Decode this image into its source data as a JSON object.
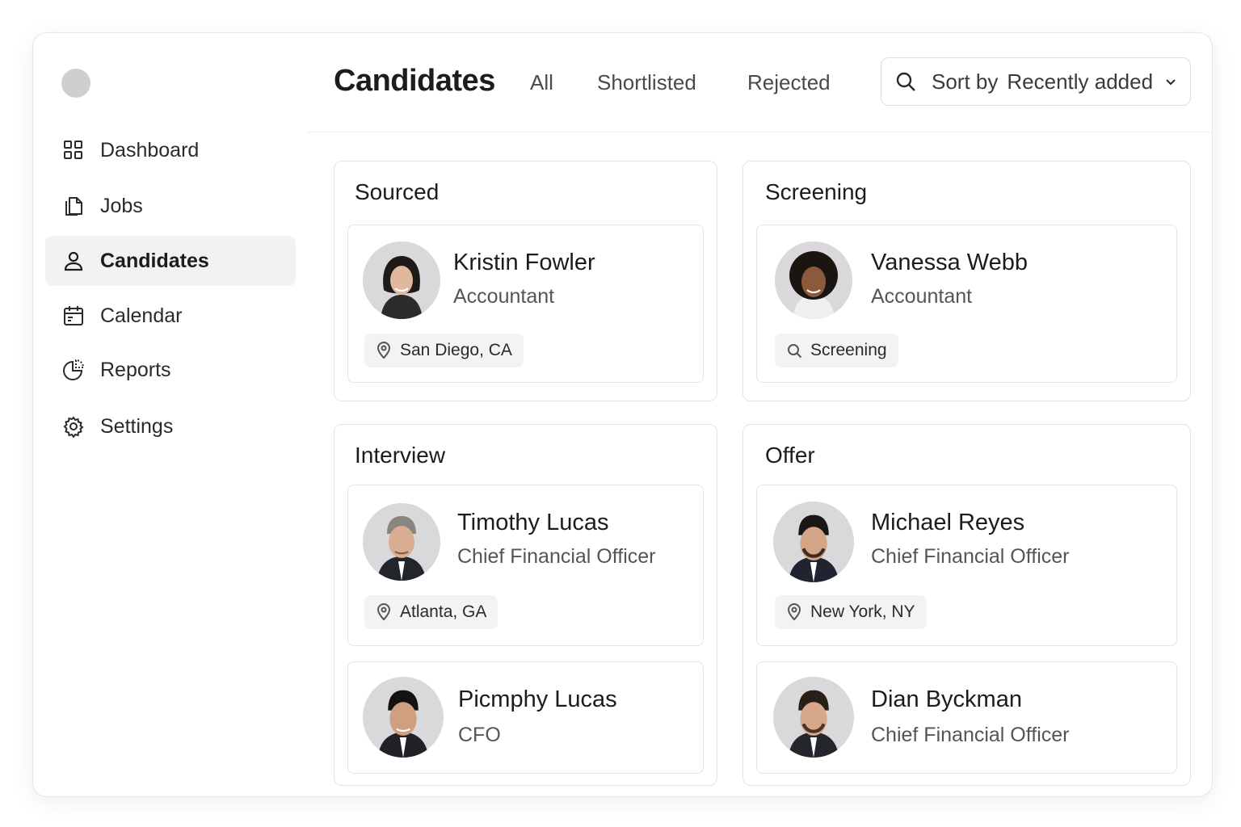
{
  "sidebar": {
    "items": [
      {
        "label": "Dashboard",
        "icon": "grid-icon",
        "active": false
      },
      {
        "label": "Jobs",
        "icon": "documents-icon",
        "active": false
      },
      {
        "label": "Candidates",
        "icon": "person-icon",
        "active": true
      },
      {
        "label": "Calendar",
        "icon": "calendar-icon",
        "active": false
      },
      {
        "label": "Reports",
        "icon": "pie-chart-icon",
        "active": false
      },
      {
        "label": "Settings",
        "icon": "gear-icon",
        "active": false
      }
    ]
  },
  "header": {
    "title": "Candidates",
    "tabs": [
      "All",
      "Shortlisted",
      "Rejected"
    ],
    "sort": {
      "label": "Sort by",
      "value": "Recently added"
    }
  },
  "columns": [
    {
      "title": "Sourced",
      "cards": [
        {
          "name": "Kristin Fowler",
          "role": "Accountant",
          "chip": "San Diego, CA",
          "chip_icon": "location-pin-icon"
        }
      ]
    },
    {
      "title": "Screening",
      "cards": [
        {
          "name": "Vanessa Webb",
          "role": "Accountant",
          "chip": "Screening",
          "chip_icon": "search-icon"
        }
      ]
    },
    {
      "title": "Interview",
      "cards": [
        {
          "name": "Timothy Lucas",
          "role": "Chief Financial Officer",
          "chip": "Atlanta, GA",
          "chip_icon": "location-pin-icon"
        },
        {
          "name": "Picmphy Lucas",
          "role": "CFO"
        }
      ]
    },
    {
      "title": "Offer",
      "cards": [
        {
          "name": "Michael Reyes",
          "role": "Chief Financial Officer",
          "chip": "New York, NY",
          "chip_icon": "location-pin-icon"
        },
        {
          "name": "Dian Byckman",
          "role": "Chief Financial Officer"
        }
      ]
    }
  ],
  "colors": {
    "accent_bg": "#f2f2f3",
    "border": "#e4e4e4",
    "text": "#1c1c1e"
  }
}
